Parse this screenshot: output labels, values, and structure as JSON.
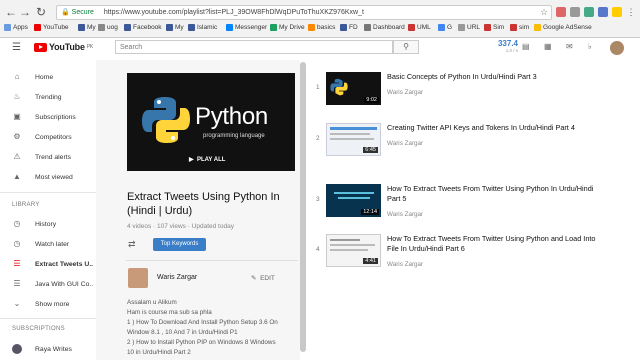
{
  "browser": {
    "address": {
      "secure": "Secure",
      "url": "https://www.youtube.com/playlist?list=PLJ_39OW8FhDlWqDPuToThuXKZ976Kxw_t"
    },
    "bookmarks": [
      "Apps",
      "YouTube",
      "My",
      "uog",
      "Facebook",
      "My",
      "Islamic",
      "Messenger",
      "My Drive",
      "basics",
      "FD",
      "Dashboard",
      "UML",
      "G",
      "URL",
      "Sim",
      "sim",
      "Google AdSense"
    ]
  },
  "youtube": {
    "logo_text": "YouTube",
    "logo_country": "PK",
    "search_placeholder": "Search",
    "header_count": "337.4",
    "header_count_sub": "1.0 / s"
  },
  "sidebar": {
    "items": [
      "Home",
      "Trending",
      "Subscriptions",
      "Competitors",
      "Trend alerts",
      "Most viewed"
    ],
    "library_heading": "LIBRARY",
    "library": [
      "History",
      "Watch later",
      "Extract Tweets U...",
      "Java With GUI Co...",
      "Show more"
    ],
    "subscriptions_heading": "SUBSCRIPTIONS",
    "subscriptions": [
      "Raya Writes"
    ]
  },
  "playlist": {
    "thumb_title": "Python",
    "thumb_sub": "programming language",
    "play_all": "PLAY ALL",
    "title": "Extract Tweets Using Python In (Hindi | Urdu)",
    "meta": "4 videos · 107 views · Updated today",
    "keywords_button": "Top Keywords",
    "author": "Waris Zargar",
    "edit": "EDIT",
    "description": [
      "Assalam u Alikum",
      "Ham is course ma sub sa phla",
      "1 ) How To Download And Install Python Setup 3.6 On",
      "Window 8.1 , 10 And 7 in Urdu/Hindi P1",
      "2 ) How to Install Python PIP on Windows 8 Windows",
      "10 in Urdu/Hindi Part 2"
    ]
  },
  "videos": [
    {
      "num": "1",
      "title": "Basic Concepts of Python In Urdu/Hindi Part 3",
      "channel": "Waris Zargar",
      "duration": "9:02"
    },
    {
      "num": "2",
      "title": "Creating Twitter API Keys and Tokens In Urdu/Hindi Part 4",
      "channel": "Waris Zargar",
      "duration": "6:45"
    },
    {
      "num": "3",
      "title": "How To Extract Tweets From Twitter Using Python In Urdu/Hindi Part 5",
      "channel": "Waris Zargar",
      "duration": "12:14"
    },
    {
      "num": "4",
      "title": "How To Extract Tweets From Twitter Using Python and Load Into File In Urdu/Hindi Part 6",
      "channel": "Waris Zargar",
      "duration": "4:41"
    }
  ],
  "colors": {
    "youtube_red": "#e00000",
    "button_blue": "#3a7ec8",
    "thumb_blue": "#0d3b57"
  }
}
